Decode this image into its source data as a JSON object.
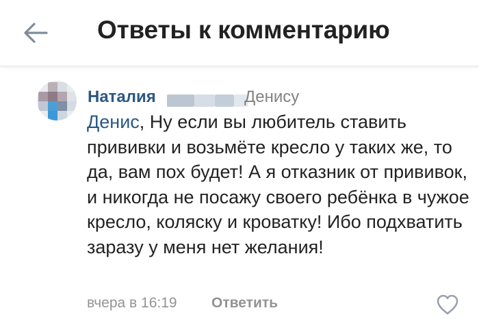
{
  "header": {
    "title": "Ответы к комментарию",
    "back_icon": "arrow-left-icon"
  },
  "comment": {
    "author": "Наталия",
    "reply_to": "Денису",
    "mention": "Денис",
    "text": ", Ну если вы любитель ставить прививки и возьмёте кресло у таких же, то да, вам пох будет! А я отказник от прививок, и никогда не посажу своего ребёнка в чужое кресло, коляску и кроватку! Ибо подхватить заразу у меня нет желания!",
    "timestamp": "вчера в 16:19",
    "reply_label": "Ответить",
    "like_icon": "heart-icon"
  },
  "colors": {
    "link": "#2a5885",
    "text": "#222222",
    "muted": "#939393"
  }
}
